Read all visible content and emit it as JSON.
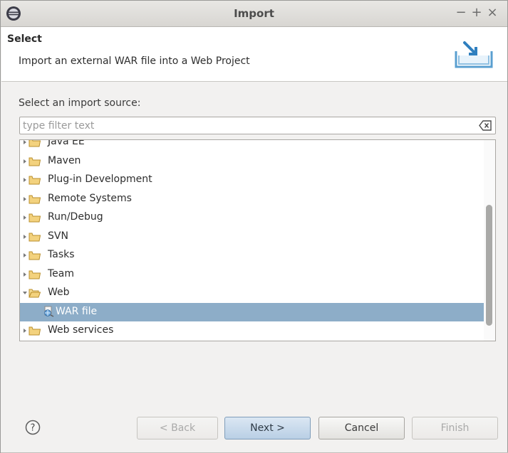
{
  "window": {
    "title": "Import",
    "controls": {
      "minimize": "−",
      "maximize": "+",
      "close": "×"
    }
  },
  "banner": {
    "title": "Select",
    "description": "Import an external WAR file into a Web Project",
    "icon": "import-wizard-icon"
  },
  "source": {
    "label": "Select an import source:",
    "filter_placeholder": "type filter text",
    "filter_value": ""
  },
  "tree": {
    "items": [
      {
        "label": "Java EE",
        "type": "folder",
        "expanded": false
      },
      {
        "label": "Maven",
        "type": "folder",
        "expanded": false
      },
      {
        "label": "Plug-in Development",
        "type": "folder",
        "expanded": false
      },
      {
        "label": "Remote Systems",
        "type": "folder",
        "expanded": false
      },
      {
        "label": "Run/Debug",
        "type": "folder",
        "expanded": false
      },
      {
        "label": "SVN",
        "type": "folder",
        "expanded": false
      },
      {
        "label": "Tasks",
        "type": "folder",
        "expanded": false
      },
      {
        "label": "Team",
        "type": "folder",
        "expanded": false
      },
      {
        "label": "Web",
        "type": "folder",
        "expanded": true
      },
      {
        "label": "WAR file",
        "type": "war-file",
        "selected": true
      },
      {
        "label": "Web services",
        "type": "folder",
        "expanded": false
      }
    ]
  },
  "buttons": {
    "help": "?",
    "back": "< Back",
    "next": "Next >",
    "cancel": "Cancel",
    "finish": "Finish"
  },
  "colors": {
    "selection": "#8dadc8",
    "default_button": "#b9cfe5",
    "folder": "#e9c56a"
  }
}
